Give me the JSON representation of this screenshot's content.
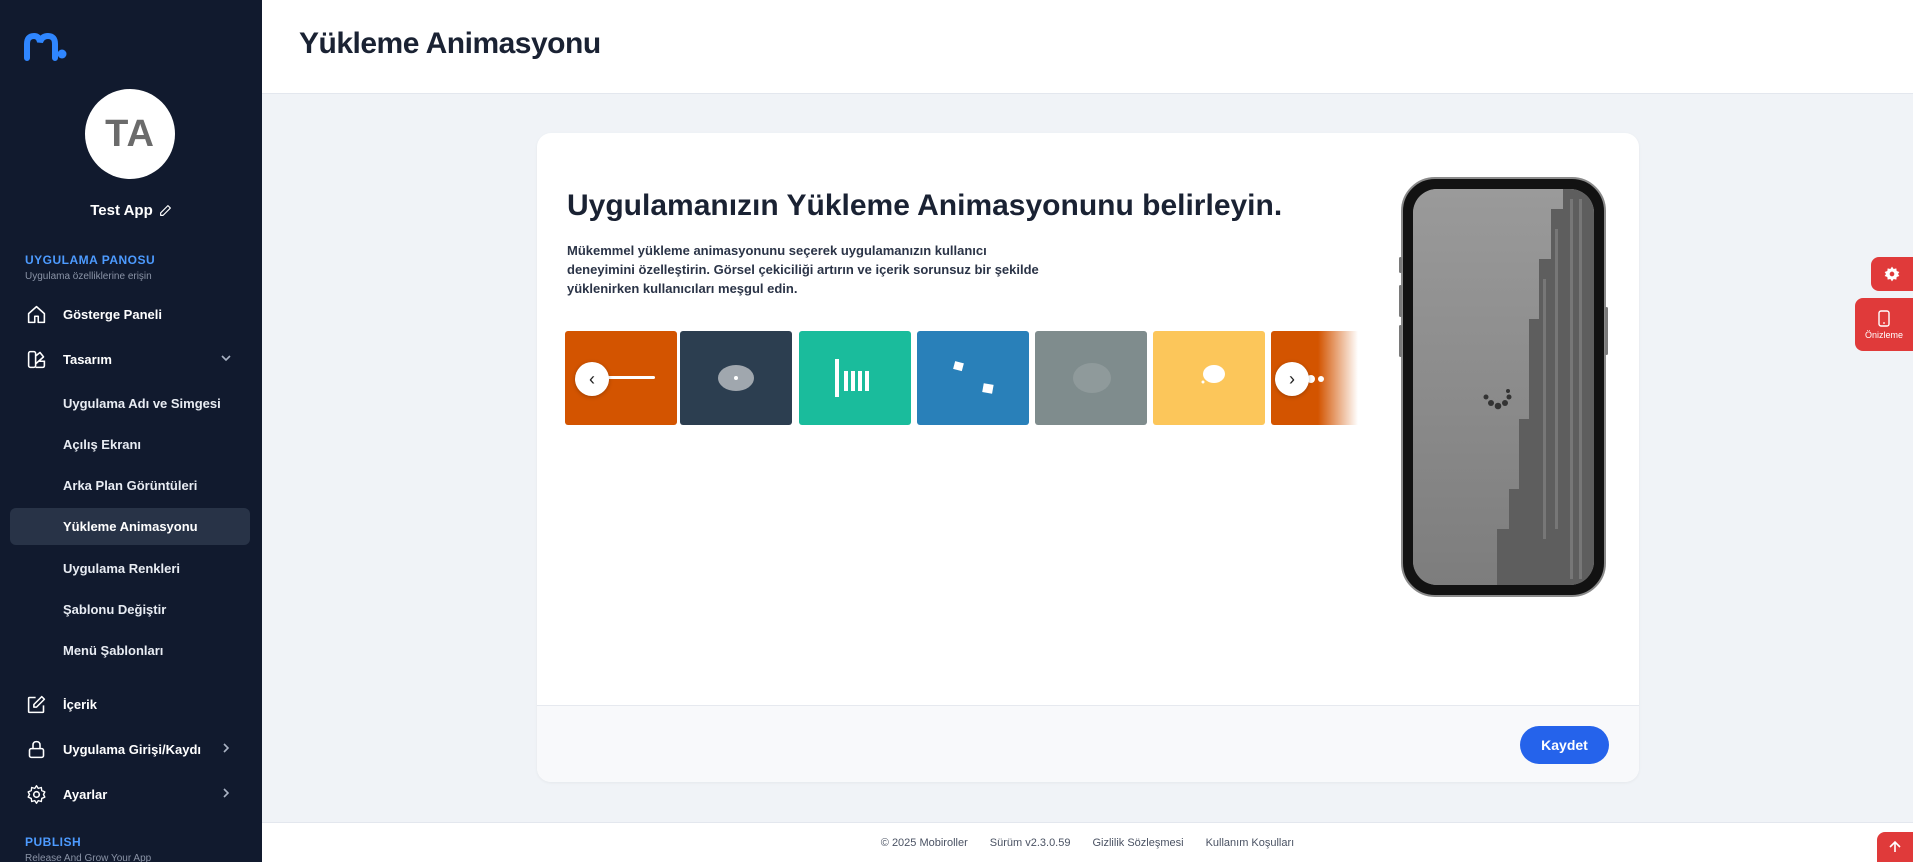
{
  "sidebar": {
    "app_initials": "TA",
    "app_name": "Test App",
    "section_dashboard": {
      "title": "UYGULAMA PANOSU",
      "subtitle": "Uygulama özelliklerine erişin"
    },
    "items": {
      "dashboard": "Gösterge Paneli",
      "design": "Tasarım",
      "content": "İçerik",
      "login": "Uygulama Girişi/Kaydı",
      "settings": "Ayarlar"
    },
    "design_sub": [
      "Uygulama Adı ve Simgesi",
      "Açılış Ekranı",
      "Arka Plan Görüntüleri",
      "Yükleme Animasyonu",
      "Uygulama Renkleri",
      "Şablonu Değiştir",
      "Menü Şablonları"
    ],
    "section_publish": {
      "title": "PUBLISH",
      "subtitle": "Release And Grow Your App"
    }
  },
  "header": {
    "title": "Yükleme Animasyonu"
  },
  "main": {
    "heading": "Uygulamanızın Yükleme Animasyonunu belirleyin.",
    "description": "Mükemmel yükleme animasyonunu seçerek uygulamanızın kullanıcı deneyimini özelleştirin. Görsel çekiciliği artırın ve içerik sorunsuz bir şekilde yüklenirken kullanıcıları meşgul edin.",
    "carousel_prev": "‹",
    "carousel_next": "›",
    "tiles": [
      "#d35400",
      "#2c3e50",
      "#1abc9c",
      "#2980b9",
      "#7f8c8d",
      "#fcc65a",
      "#d35400"
    ],
    "save_label": "Kaydet"
  },
  "floating": {
    "preview_label": "Önizleme"
  },
  "footer": {
    "copyright": "© 2025 Mobiroller",
    "version": "Sürüm v2.3.0.59",
    "privacy": "Gizlilik Sözleşmesi",
    "terms": "Kullanım Koşulları"
  }
}
